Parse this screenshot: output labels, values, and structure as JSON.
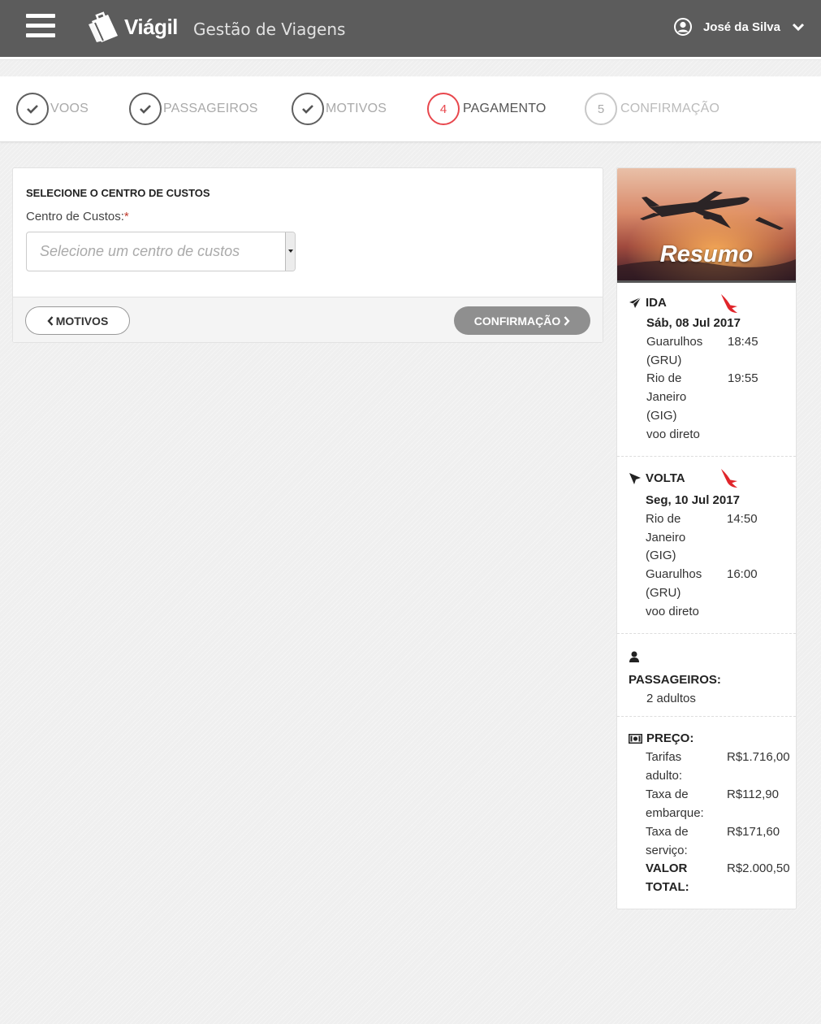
{
  "header": {
    "brand_name": "Viágil",
    "app_title": "Gestão de Viagens",
    "user_name": "José da Silva"
  },
  "steps": [
    {
      "number": "1",
      "label": "VOOS",
      "state": "done"
    },
    {
      "number": "2",
      "label": "PASSAGEIROS",
      "state": "done"
    },
    {
      "number": "3",
      "label": "MOTIVOS",
      "state": "done"
    },
    {
      "number": "4",
      "label": "PAGAMENTO",
      "state": "active"
    },
    {
      "number": "5",
      "label": "CONFIRMAÇÃO",
      "state": "pending"
    }
  ],
  "form": {
    "section_title": "SELECIONE O CENTRO DE CUSTOS",
    "field_label": "Centro de Custos:",
    "required_mark": "*",
    "select_placeholder": "Selecione um centro de custos",
    "back_label": "MOTIVOS",
    "next_label": "CONFIRMAÇÃO"
  },
  "summary": {
    "title": "Resumo",
    "ida": {
      "heading": "IDA",
      "date": "Sáb, 08 Jul 2017",
      "origin_line1": "Guarulhos",
      "origin_line2": "(GRU)",
      "origin_time": "18:45",
      "dest_line1": "Rio de",
      "dest_line2": "Janeiro",
      "dest_line3": "(GIG)",
      "dest_time": "19:55",
      "note": "voo direto"
    },
    "volta": {
      "heading": "VOLTA",
      "date": "Seg, 10 Jul 2017",
      "origin_line1": "Rio de",
      "origin_line2": "Janeiro",
      "origin_line3": "(GIG)",
      "origin_time": "14:50",
      "dest_line1": "Guarulhos",
      "dest_line2": "(GRU)",
      "dest_time": "16:00",
      "note": "voo direto"
    },
    "passengers": {
      "heading": "PASSAGEIROS:",
      "value": "2 adultos"
    },
    "price": {
      "heading": "PREÇO:",
      "fare_label_1": "Tarifas",
      "fare_label_2": "adulto:",
      "fare_value": "R$1.716,00",
      "boarding_label_1": "Taxa de",
      "boarding_label_2": "embarque:",
      "boarding_value": "R$112,90",
      "service_label_1": "Taxa de",
      "service_label_2": "serviço:",
      "service_value": "R$171,60",
      "total_label_1": "VALOR",
      "total_label_2": "TOTAL:",
      "total_value": "R$2.000,50"
    }
  },
  "colors": {
    "topbar": "#5c5c5c",
    "active_step": "#e8474d",
    "next_button": "#8f8f8f",
    "airline_logo": "#e0252b"
  }
}
